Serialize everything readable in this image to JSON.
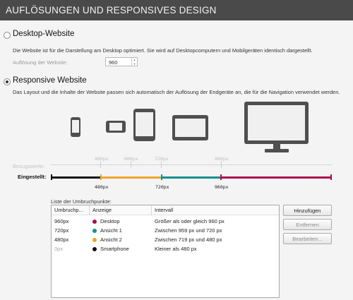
{
  "header": {
    "title": "AUFLÖSUNGEN UND RESPONSIVES DESIGN"
  },
  "desktop_option": {
    "label": "Desktop-Website",
    "selected": false,
    "description": "Die Website ist für die Darstellung am Desktop optimiert. Sie wird auf Desktopcomputern und Mobilgeräten identisch dargestellt.",
    "resolution_label": "Auflösung der Website:",
    "resolution_value": "960"
  },
  "responsive_option": {
    "label": "Responsive Website",
    "selected": true,
    "description": "Das Layout und die Inhalte der Website passen sich automatisch der Auflösung der Endgeräte an, die für die Navigation verwendet werden."
  },
  "devices": [
    "smartphone-icon",
    "tablet-landscape-icon",
    "tablet-portrait-icon",
    "small-laptop-icon",
    "desktop-monitor-icon"
  ],
  "reference_scale": {
    "label": "Bezugswerte:",
    "ticks": [
      "480px",
      "600px",
      "720px",
      "960px"
    ]
  },
  "set_scale": {
    "label": "Eingestellt:",
    "ticks": [
      "480px",
      "720px",
      "960px"
    ],
    "colors": [
      "#111111",
      "#f0a52c",
      "#13918f",
      "#a8104e"
    ]
  },
  "breakpoints": {
    "label": "Liste der Umbruchpunkte:",
    "columns": [
      "Umbruchp...",
      "Anzeige",
      "Intervall"
    ],
    "rows": [
      {
        "breakpoint": "960px",
        "display": "Desktop",
        "color": "#a8104e",
        "interval": "Größer als oder gleich 960 px"
      },
      {
        "breakpoint": "720px",
        "display": "Ansicht 1",
        "color": "#13918f",
        "interval": "Zwischen 959 px und 720 px"
      },
      {
        "breakpoint": "480px",
        "display": "Ansicht 2",
        "color": "#f0a52c",
        "interval": "Zwischen 719 px und 480 px"
      },
      {
        "breakpoint": "0px",
        "display": "Smartphone",
        "color": "#111111",
        "interval": "Kleiner als 480 px"
      }
    ]
  },
  "buttons": {
    "add": "Hinzufügen",
    "remove": "Entfernen",
    "edit": "Bearbeiten..."
  }
}
